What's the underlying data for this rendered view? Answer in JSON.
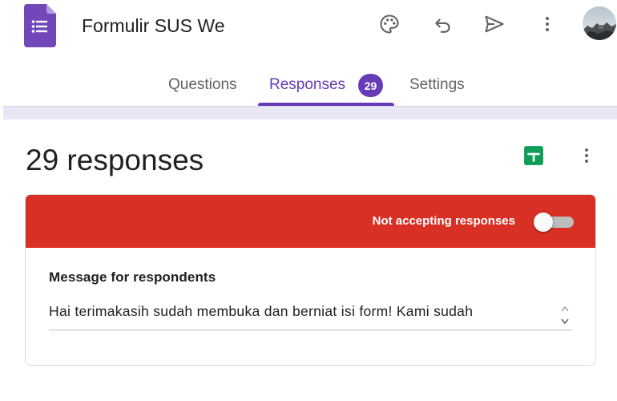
{
  "header": {
    "doc_title": "Formulir SUS We",
    "icons": [
      "forms-logo-icon",
      "palette-icon",
      "undo-icon",
      "send-icon",
      "more-vert-icon",
      "avatar"
    ]
  },
  "tabs": [
    {
      "label": "Questions",
      "active": false
    },
    {
      "label": "Responses",
      "active": true,
      "badge": "29"
    },
    {
      "label": "Settings",
      "active": false
    }
  ],
  "responses": {
    "title": "29 responses",
    "status_text": "Not accepting responses",
    "accepting": false,
    "message_label": "Message for respondents",
    "message_value": "Hai terimakasih sudah membuka dan berniat isi form! Kami sudah"
  },
  "colors": {
    "accent": "#673ab7",
    "banner": "#d93025",
    "sheets": "#0f9d58",
    "band": "#eae7f5"
  }
}
